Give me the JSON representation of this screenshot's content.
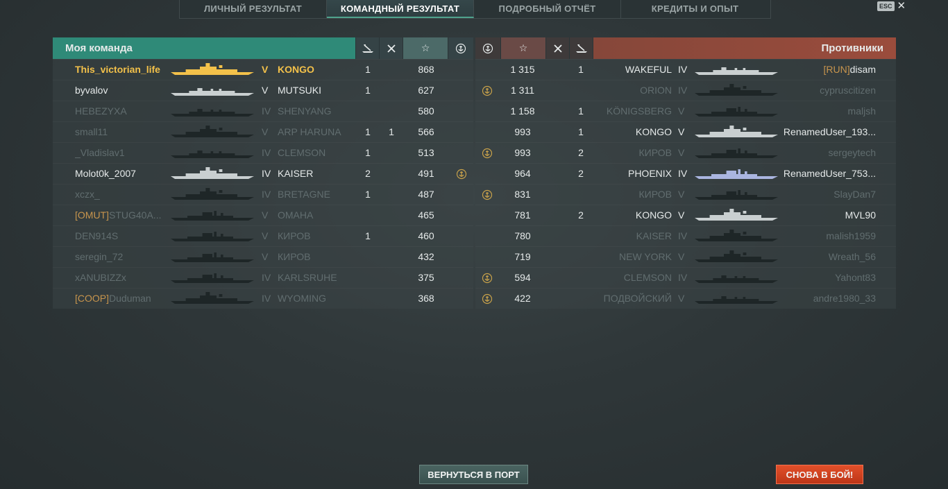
{
  "tabs": [
    {
      "label": "ЛИЧНЫЙ РЕЗУЛЬТАТ",
      "active": false
    },
    {
      "label": "КОМАНДНЫЙ РЕЗУЛЬТАТ",
      "active": true
    },
    {
      "label": "ПОДРОБНЫЙ ОТЧЁТ",
      "active": false
    },
    {
      "label": "КРЕДИТЫ И ОПЫТ",
      "active": false
    }
  ],
  "esc_label": "ESC",
  "left_team": {
    "title": "Моя команда",
    "header_icons": [
      "ship-kill-icon",
      "plane-kill-icon",
      "star-icon",
      "base-capture-icon"
    ],
    "players": [
      {
        "clan": "",
        "name": "This_victorian_life",
        "tier": "V",
        "ship": "KONGO",
        "kills": "1",
        "planes": "",
        "score": "868",
        "base": false,
        "style": "self",
        "ship_class": "battleship"
      },
      {
        "clan": "",
        "name": "byvalov",
        "tier": "V",
        "ship": "MUTSUKI",
        "kills": "1",
        "planes": "",
        "score": "627",
        "base": false,
        "style": "alive",
        "ship_class": "destroyer"
      },
      {
        "clan": "",
        "name": "HEBEZYXA",
        "tier": "IV",
        "ship": "SHENYANG",
        "kills": "",
        "planes": "",
        "score": "580",
        "base": false,
        "style": "dead",
        "ship_class": "destroyer"
      },
      {
        "clan": "",
        "name": "small11",
        "tier": "V",
        "ship": "ARP HARUNA",
        "kills": "1",
        "planes": "1",
        "score": "566",
        "base": false,
        "style": "dead",
        "ship_class": "battleship"
      },
      {
        "clan": "",
        "name": "_Vladislav1",
        "tier": "IV",
        "ship": "CLEMSON",
        "kills": "1",
        "planes": "",
        "score": "513",
        "base": false,
        "style": "dead",
        "ship_class": "destroyer"
      },
      {
        "clan": "",
        "name": "Molot0k_2007",
        "tier": "IV",
        "ship": "KAISER",
        "kills": "2",
        "planes": "",
        "score": "491",
        "base": true,
        "style": "alive",
        "ship_class": "battleship"
      },
      {
        "clan": "",
        "name": "xczx_",
        "tier": "IV",
        "ship": "BRETAGNE",
        "kills": "1",
        "planes": "",
        "score": "487",
        "base": false,
        "style": "dead",
        "ship_class": "battleship"
      },
      {
        "clan": "[OMUT]",
        "name": "STUG40A...",
        "tier": "V",
        "ship": "OMAHA",
        "kills": "",
        "planes": "",
        "score": "465",
        "base": false,
        "style": "dead",
        "ship_class": "cruiser"
      },
      {
        "clan": "",
        "name": "DEN914S",
        "tier": "V",
        "ship": "КИРОВ",
        "kills": "1",
        "planes": "",
        "score": "460",
        "base": false,
        "style": "dead",
        "ship_class": "cruiser"
      },
      {
        "clan": "",
        "name": "seregin_72",
        "tier": "V",
        "ship": "КИРОВ",
        "kills": "",
        "planes": "",
        "score": "432",
        "base": false,
        "style": "dead",
        "ship_class": "cruiser"
      },
      {
        "clan": "",
        "name": "xANUBIZZx",
        "tier": "IV",
        "ship": "KARLSRUHE",
        "kills": "",
        "planes": "",
        "score": "375",
        "base": false,
        "style": "dead",
        "ship_class": "cruiser"
      },
      {
        "clan": "[COOP]",
        "name": "Duduman",
        "tier": "IV",
        "ship": "WYOMING",
        "kills": "",
        "planes": "",
        "score": "368",
        "base": false,
        "style": "dead",
        "ship_class": "battleship"
      }
    ]
  },
  "right_team": {
    "title": "Противники",
    "header_icons": [
      "base-capture-icon",
      "star-icon",
      "plane-kill-icon",
      "ship-kill-icon"
    ],
    "players": [
      {
        "base": false,
        "score": "1 315",
        "kills": "1",
        "ship": "WAKEFUL",
        "tier": "IV",
        "clan": "[RUN]",
        "name": "disam",
        "style": "alive",
        "ship_class": "destroyer"
      },
      {
        "base": true,
        "score": "1 311",
        "kills": "",
        "ship": "ORION",
        "tier": "IV",
        "clan": "",
        "name": "cypruscitizen",
        "style": "dead",
        "ship_class": "battleship"
      },
      {
        "base": false,
        "score": "1 158",
        "kills": "1",
        "ship": "KÖNIGSBERG",
        "tier": "V",
        "clan": "",
        "name": "maljsh",
        "style": "dead",
        "ship_class": "cruiser"
      },
      {
        "base": false,
        "score": "993",
        "kills": "1",
        "ship": "KONGO",
        "tier": "V",
        "clan": "",
        "name": "RenamedUser_193...",
        "style": "alive",
        "ship_class": "battleship"
      },
      {
        "base": true,
        "score": "993",
        "kills": "2",
        "ship": "КИРОВ",
        "tier": "V",
        "clan": "",
        "name": "sergeytech",
        "style": "dead",
        "ship_class": "cruiser"
      },
      {
        "base": false,
        "score": "964",
        "kills": "2",
        "ship": "PHOENIX",
        "tier": "IV",
        "clan": "",
        "name": "RenamedUser_753...",
        "style": "alive",
        "ship_class": "cruiser"
      },
      {
        "base": true,
        "score": "831",
        "kills": "",
        "ship": "КИРОВ",
        "tier": "V",
        "clan": "",
        "name": "SlayDan7",
        "style": "dead",
        "ship_class": "cruiser"
      },
      {
        "base": false,
        "score": "781",
        "kills": "2",
        "ship": "KONGO",
        "tier": "V",
        "clan": "",
        "name": "MVL90",
        "style": "alive",
        "ship_class": "battleship"
      },
      {
        "base": false,
        "score": "780",
        "kills": "",
        "ship": "KAISER",
        "tier": "IV",
        "clan": "",
        "name": "malish1959",
        "style": "dead",
        "ship_class": "battleship"
      },
      {
        "base": false,
        "score": "719",
        "kills": "",
        "ship": "NEW YORK",
        "tier": "V",
        "clan": "",
        "name": "Wreath_56",
        "style": "dead",
        "ship_class": "battleship"
      },
      {
        "base": true,
        "score": "594",
        "kills": "",
        "ship": "CLEMSON",
        "tier": "IV",
        "clan": "",
        "name": "Yahont83",
        "style": "dead",
        "ship_class": "destroyer"
      },
      {
        "base": true,
        "score": "422",
        "kills": "",
        "ship": "ПОДВОЙСКИЙ",
        "tier": "V",
        "clan": "",
        "name": "andre1980_33",
        "style": "dead",
        "ship_class": "destroyer"
      }
    ]
  },
  "buttons": {
    "return_to_port": "ВЕРНУТЬСЯ В ПОРТ",
    "battle_again": "СНОВА В БОЙ!"
  },
  "colors": {
    "ally_accent": "#2f8a78",
    "enemy_accent": "#9a4c3c",
    "self_highlight": "#f3c14a",
    "clan_tag": "#c8954d",
    "battle_button": "#d2421f"
  }
}
